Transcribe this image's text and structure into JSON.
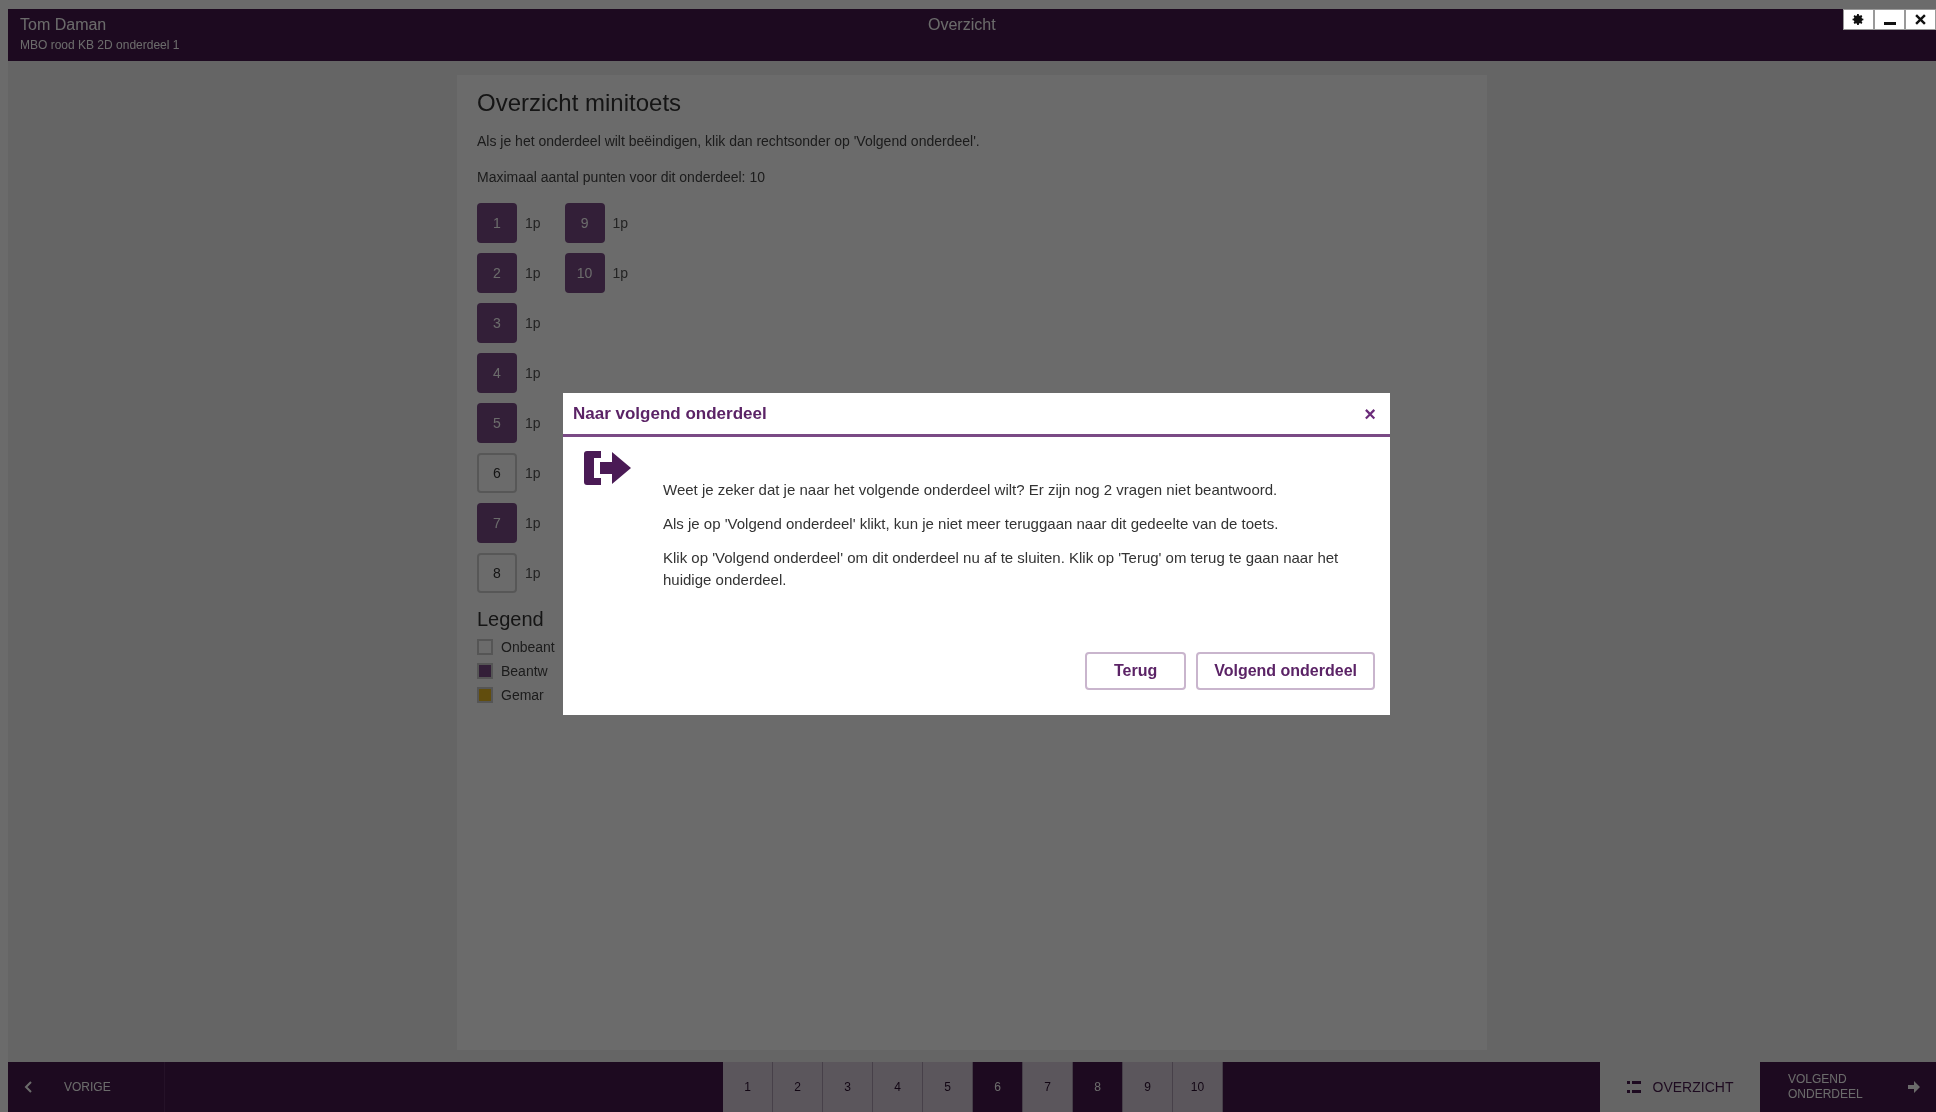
{
  "header": {
    "user": "Tom Daman",
    "subtitle": "MBO rood KB 2D onderdeel 1",
    "title": "Overzicht"
  },
  "overview": {
    "heading": "Overzicht minitoets",
    "instruction": "Als je het onderdeel wilt beëindigen, klik dan rechtsonder op 'Volgend onderdeel'.",
    "max_points": "Maximaal aantal punten voor dit onderdeel: 10",
    "columns": [
      {
        "questions": [
          {
            "number": "1",
            "points": "1p",
            "answered": true
          },
          {
            "number": "2",
            "points": "1p",
            "answered": true
          },
          {
            "number": "3",
            "points": "1p",
            "answered": true
          },
          {
            "number": "4",
            "points": "1p",
            "answered": true
          },
          {
            "number": "5",
            "points": "1p",
            "answered": true
          },
          {
            "number": "6",
            "points": "1p",
            "answered": false
          },
          {
            "number": "7",
            "points": "1p",
            "answered": true
          },
          {
            "number": "8",
            "points": "1p",
            "answered": false
          }
        ]
      },
      {
        "questions": [
          {
            "number": "9",
            "points": "1p",
            "answered": true
          },
          {
            "number": "10",
            "points": "1p",
            "answered": true
          }
        ]
      }
    ],
    "legend": {
      "title": "Legend",
      "items": [
        {
          "label": "Onbeant",
          "color": "#6b6b6b"
        },
        {
          "label": "Beantw",
          "color": "#331f38"
        },
        {
          "label": "Gemar",
          "color": "#614d0d"
        }
      ]
    }
  },
  "dialog": {
    "title": "Naar volgend onderdeel",
    "close": "×",
    "paragraphs": [
      "Weet je zeker dat je naar het volgende onderdeel wilt? Er zijn nog 2 vragen niet beantwoord.",
      "Als je op 'Volgend onderdeel' klikt, kun je niet meer teruggaan naar dit gedeelte van de toets.",
      "Klik op 'Volgend onderdeel' om dit onderdeel nu af te sluiten. Klik op 'Terug' om terug te gaan naar het huidige onderdeel."
    ],
    "buttons": [
      "Terug",
      "Volgend onderdeel"
    ]
  },
  "footer": {
    "previous": "VORIGE",
    "pages": [
      {
        "label": "1",
        "answered": true
      },
      {
        "label": "2",
        "answered": true
      },
      {
        "label": "3",
        "answered": true
      },
      {
        "label": "4",
        "answered": true
      },
      {
        "label": "5",
        "answered": true
      },
      {
        "label": "6",
        "answered": false
      },
      {
        "label": "7",
        "answered": true
      },
      {
        "label": "8",
        "answered": false
      },
      {
        "label": "9",
        "answered": true
      },
      {
        "label": "10",
        "answered": true
      }
    ],
    "overview": "OVERZICHT",
    "next": "VOLGEND ONDERDEEL"
  }
}
